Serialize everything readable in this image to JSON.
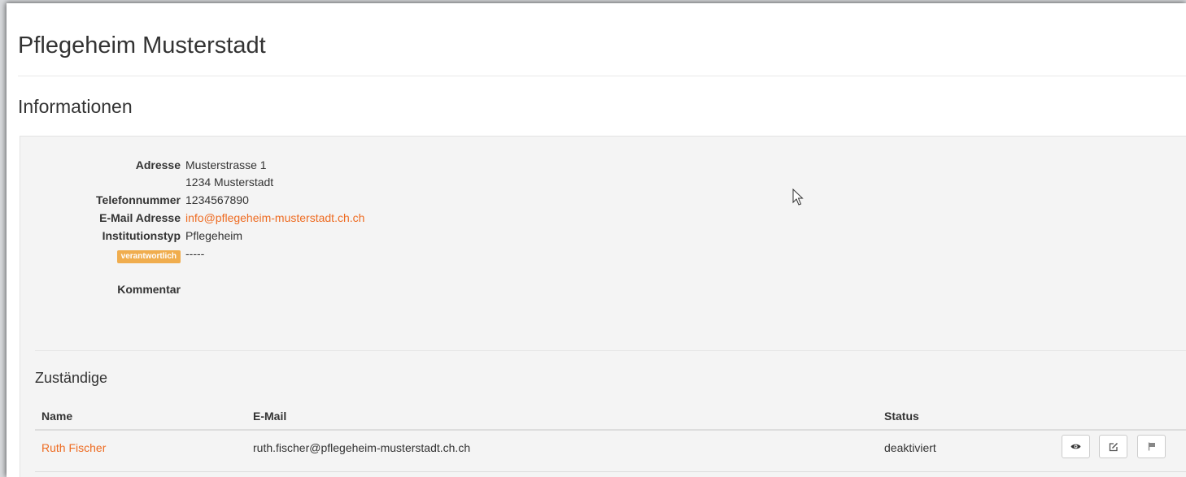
{
  "page": {
    "title": "Pflegeheim Musterstadt"
  },
  "info": {
    "section_title": "Informationen",
    "address_label": "Adresse",
    "address_line1": "Musterstrasse 1",
    "address_line2": "1234 Musterstadt",
    "phone_label": "Telefonnummer",
    "phone_value": "1234567890",
    "email_label": "E-Mail Adresse",
    "email_value": "info@pflegeheim-musterstadt.ch.ch",
    "type_label": "Institutionstyp",
    "type_value": "Pflegeheim",
    "responsible_badge": "verantwortlich",
    "responsible_value": "-----",
    "comment_label": "Kommentar",
    "comment_value": ""
  },
  "responsibles": {
    "title": "Zuständige",
    "columns": [
      "Name",
      "E-Mail",
      "Status"
    ],
    "rows": [
      {
        "name": "Ruth Fischer",
        "email": "ruth.fischer@pflegeheim-musterstadt.ch.ch",
        "status": "deaktiviert"
      }
    ]
  },
  "icons": {
    "view": "eye-icon",
    "edit": "edit-icon",
    "flag": "flag-icon"
  },
  "colors": {
    "link": "#ee6b21",
    "badge": "#f0ad4e",
    "panel_background": "#f4f4f4"
  }
}
